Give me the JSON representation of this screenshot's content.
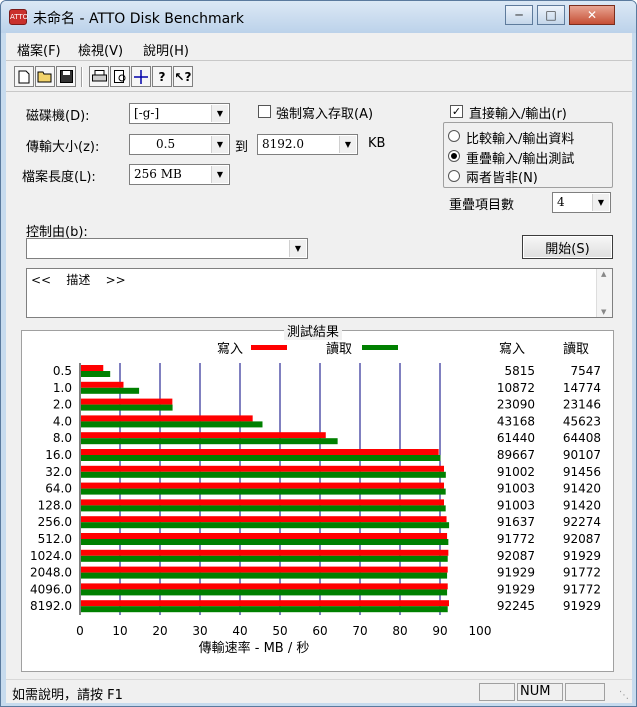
{
  "window": {
    "title": "未命名 - ATTO Disk Benchmark",
    "icon_text": "ATTO"
  },
  "menu": [
    "檔案(F)",
    "檢視(V)",
    "說明(H)"
  ],
  "toolbar_icons": [
    "new-file-icon",
    "open-folder-icon",
    "save-icon",
    "print-icon",
    "print-preview-icon",
    "move-icon",
    "help-icon",
    "context-help-icon"
  ],
  "settings": {
    "drive_label": "磁碟機(D):",
    "drive_value": "[-g-]",
    "force_write_label": "強制寫入存取(A)",
    "force_write_checked": false,
    "direct_io_label": "直接輸入/輸出(r)",
    "direct_io_checked": true,
    "transfer_label": "傳輸大小(z):",
    "transfer_from": "0.5",
    "transfer_to_label": "到",
    "transfer_to": "8192.0",
    "transfer_unit": "KB",
    "file_length_label": "檔案長度(L):",
    "file_length_value": "256 MB",
    "radio_options": [
      {
        "label": "比較輸入/輸出資料",
        "selected": false
      },
      {
        "label": "重疊輸入/輸出測試",
        "selected": true
      },
      {
        "label": "兩者皆非(N)",
        "selected": false
      }
    ],
    "queue_label": "重疊項目數",
    "queue_value": "4",
    "controlled_by_label": "控制由(b):",
    "controlled_by_value": "",
    "start_button": "開始(S)",
    "description_text": "<<    描述    >>"
  },
  "results": {
    "title": "測試結果",
    "legend_write": "寫入",
    "legend_read": "讀取",
    "col_write": "寫入",
    "col_read": "讀取",
    "colors": {
      "write": "#ff0000",
      "read": "#008000"
    }
  },
  "chart_data": {
    "type": "bar",
    "orientation": "horizontal",
    "xlabel": "傳輸速率 - MB / 秒",
    "xlim": [
      0,
      100
    ],
    "x_ticks": [
      "0",
      "10",
      "20",
      "30",
      "40",
      "50",
      "60",
      "70",
      "80",
      "90",
      "100"
    ],
    "categories": [
      "0.5",
      "1.0",
      "2.0",
      "4.0",
      "8.0",
      "16.0",
      "32.0",
      "64.0",
      "128.0",
      "256.0",
      "512.0",
      "1024.0",
      "2048.0",
      "4096.0",
      "8192.0"
    ],
    "series": [
      {
        "name": "寫入",
        "values": [
          5.815,
          10.872,
          23.09,
          43.168,
          61.44,
          89.667,
          91.002,
          91.003,
          91.003,
          91.637,
          91.772,
          92.087,
          91.929,
          91.929,
          92.245
        ]
      },
      {
        "name": "讀取",
        "values": [
          7.547,
          14.774,
          23.146,
          45.623,
          64.408,
          90.107,
          91.456,
          91.42,
          91.42,
          92.274,
          92.087,
          91.929,
          91.772,
          91.772,
          91.929
        ]
      }
    ],
    "write_labels": [
      "5815",
      "10872",
      "23090",
      "43168",
      "61440",
      "89667",
      "91002",
      "91003",
      "91003",
      "91637",
      "91772",
      "92087",
      "91929",
      "91929",
      "92245"
    ],
    "read_labels": [
      "7547",
      "14774",
      "23146",
      "45623",
      "64408",
      "90107",
      "91456",
      "91420",
      "91420",
      "92274",
      "92087",
      "91929",
      "91772",
      "91772",
      "91929"
    ]
  },
  "status": {
    "help_text": "如需說明，請按 F1",
    "num_indicator": "NUM"
  }
}
